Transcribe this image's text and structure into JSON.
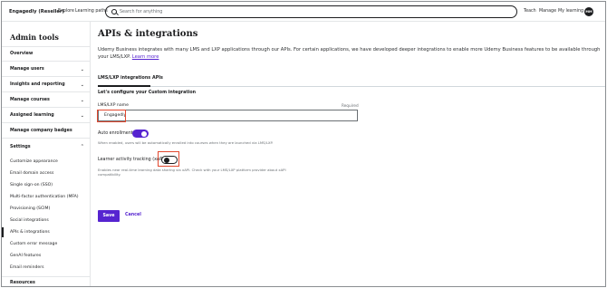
{
  "header": {
    "brand": "Engagedly (Reseller)",
    "nav_left": [
      "Explore",
      "Learning paths"
    ],
    "search_placeholder": "Search for anything",
    "nav_right": [
      "Teach",
      "Manage",
      "My learning"
    ],
    "avatar_initials": "MM"
  },
  "sidebar": {
    "title": "Admin tools",
    "items": [
      {
        "label": "Overview",
        "chevron": ""
      },
      {
        "label": "Manage users",
        "chevron": "⌄"
      },
      {
        "label": "Insights and reporting",
        "chevron": "⌄"
      },
      {
        "label": "Manage courses",
        "chevron": "⌄"
      },
      {
        "label": "Assigned learning",
        "chevron": "⌄"
      },
      {
        "label": "Manage company badges",
        "chevron": ""
      },
      {
        "label": "Settings",
        "chevron": "⌃"
      }
    ],
    "settings_subitems": [
      "Customize appearance",
      "Email domain access",
      "Single sign-on (SSO)",
      "Multi-factor authentication (MFA)",
      "Provisioning (SCIM)",
      "Social integrations",
      "APIs & integrations",
      "Custom error message",
      "GenAI features",
      "Email reminders"
    ],
    "active_subitem": "APIs & integrations",
    "bottom_item": "Resources"
  },
  "main": {
    "title": "APIs & integrations",
    "intro": "Udemy Business integrates with many LMS and LXP applications through our APIs. For certain applications, we have developed deeper integrations to enable more Udemy Business features to be available through your LMS/LXP.",
    "learn_more": "Learn more",
    "tabs": [
      "LMS/LXP integrations",
      "APIs"
    ],
    "section_heading": "Let's configure your Custom integration",
    "field_label": "LMS/LXP name",
    "required_text": "Required",
    "field_value": "Engagedly",
    "auto_enrollment_label": "Auto enrollment",
    "auto_enrollment_help": "When enabled, users will be automatically enrolled into courses when they are launched via LMS/LXP.",
    "lat_label": "Learner activity tracking (xAPI)",
    "lat_help": "Enables near real-time learning data sharing via xAPI. Check with your LMS/LXP platform provider about xAPI compatibility.",
    "save_label": "Save",
    "cancel_label": "Cancel"
  },
  "colors": {
    "accent": "#5624d0",
    "highlight": "#e2482f",
    "text": "#1c1d1f"
  }
}
